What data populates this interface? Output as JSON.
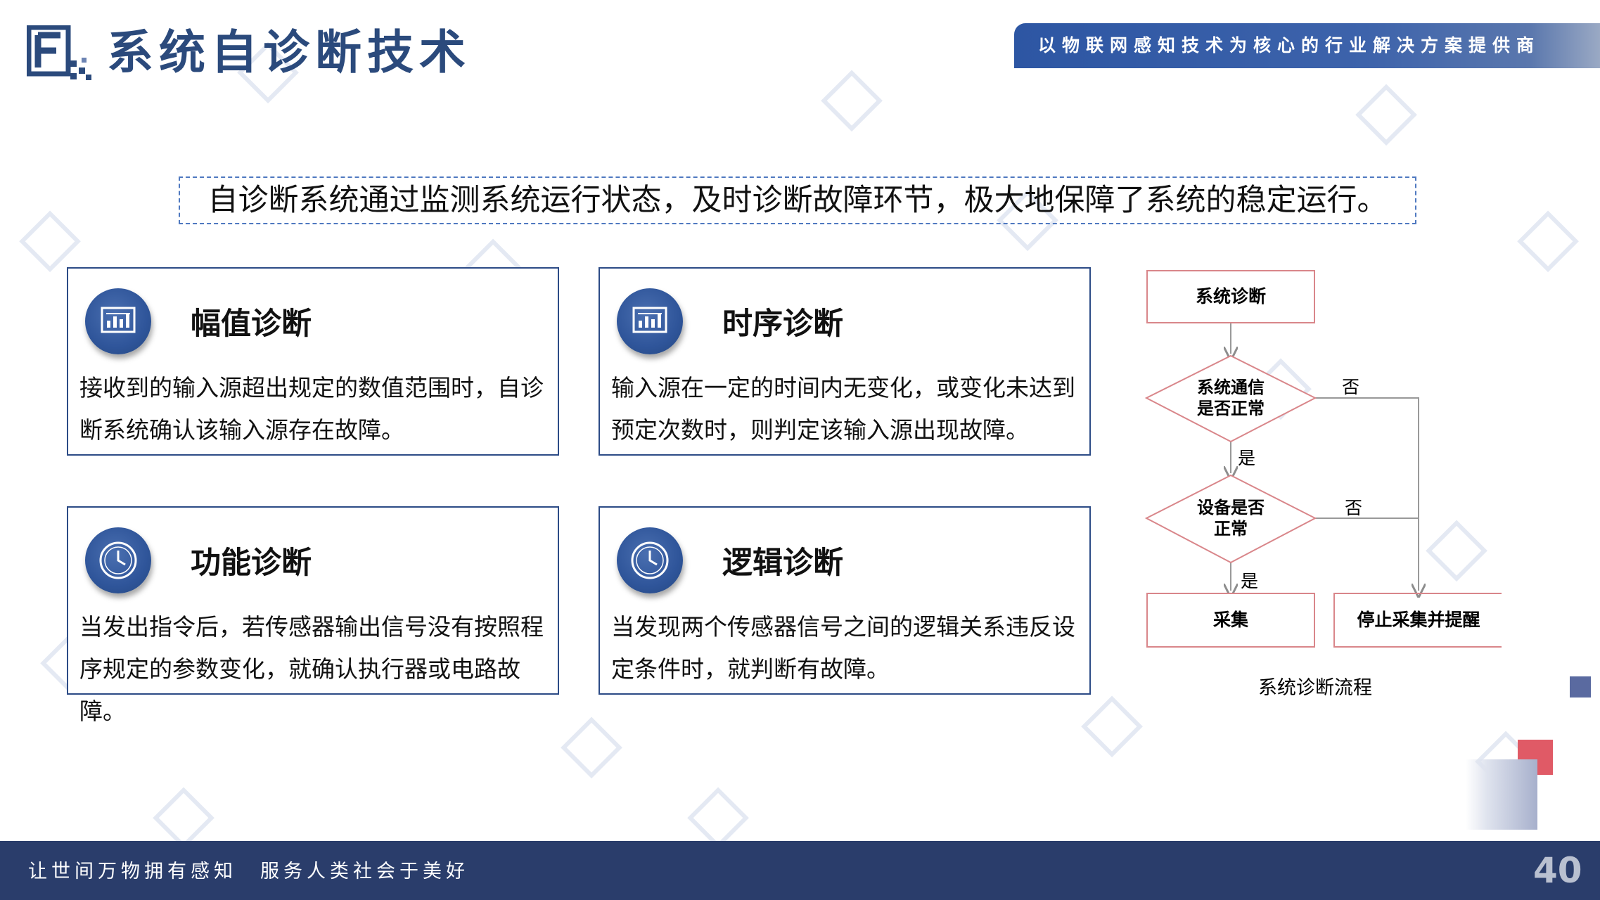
{
  "header": {
    "title": "系统自诊断技术",
    "slogan": "以物联网感知技术为核心的行业解决方案提供商"
  },
  "summary": "自诊断系统通过监测系统运行状态，及时诊断故障环节，极大地保障了系统的稳定运行。",
  "cards": [
    {
      "title": "幅值诊断",
      "icon": "chart-icon",
      "text": "接收到的输入源超出规定的数值范围时，自诊断系统确认该输入源存在故障。"
    },
    {
      "title": "时序诊断",
      "icon": "chart-icon",
      "text": "输入源在一定的时间内无变化，或变化未达到预定次数时，则判定该输入源出现故障。"
    },
    {
      "title": "功能诊断",
      "icon": "clock-icon",
      "text": "当发出指令后，若传感器输出信号没有按照程序规定的参数变化，就确认执行器或电路故障。"
    },
    {
      "title": "逻辑诊断",
      "icon": "clock-icon",
      "text": "当发现两个传感器信号之间的逻辑关系违反设定条件时，就判断有故障。"
    }
  ],
  "flowchart": {
    "start": "系统诊断",
    "decision1": [
      "系统通信",
      "是否正常"
    ],
    "decision2": [
      "设备是否",
      "正常"
    ],
    "yes": "是",
    "no": "否",
    "collect": "采集",
    "stop": "停止采集并提醒",
    "caption": "系统诊断流程"
  },
  "footer": {
    "text": "让世间万物拥有感知　服务人类社会于美好",
    "page_number": "40"
  },
  "colors": {
    "primary": "#2d56a3",
    "navy": "#2a3d6b",
    "card_border": "#2c4b86",
    "flow_border": "#d9868a",
    "accent_red": "#e05a66"
  }
}
